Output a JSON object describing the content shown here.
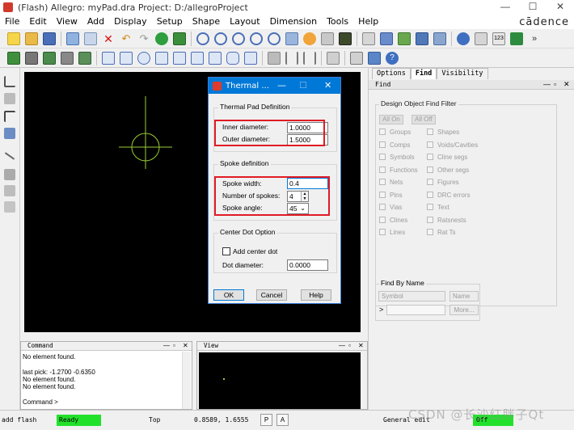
{
  "window": {
    "title": "(Flash) Allegro: myPad.dra  Project: D:/allegroProject",
    "minimize": "—",
    "maximize": "☐",
    "close": "✕"
  },
  "menu": [
    "File",
    "Edit",
    "View",
    "Add",
    "Display",
    "Setup",
    "Shape",
    "Layout",
    "Dimension",
    "Tools",
    "Help"
  ],
  "brand": "cādence",
  "toolbar_overflow": "»",
  "dialog": {
    "title": "Thermal ...",
    "thermal_pad": {
      "label": "Thermal Pad Definition",
      "inner_label": "Inner diameter:",
      "inner_value": "1.0000",
      "outer_label": "Outer diameter:",
      "outer_value": "1.5000"
    },
    "spoke": {
      "label": "Spoke definition",
      "width_label": "Spoke width:",
      "width_value": "0.4",
      "number_label": "Number of spokes:",
      "number_value": "4",
      "angle_label": "Spoke angle:",
      "angle_value": "45"
    },
    "center_dot": {
      "label": "Center Dot Option",
      "add_label": "Add center dot",
      "add_checked": false,
      "diameter_label": "Dot diameter:",
      "diameter_value": "0.0000"
    },
    "buttons": {
      "ok": "OK",
      "cancel": "Cancel",
      "help": "Help"
    }
  },
  "right_panel": {
    "tabs": [
      "Options",
      "Find",
      "Visibility"
    ],
    "active_tab": "Find",
    "header": "Find",
    "filter_title": "Design Object Find Filter",
    "all_on": "All On",
    "all_off": "All Off",
    "left_items": [
      "Groups",
      "Comps",
      "Symbols",
      "Functions",
      "Nets",
      "Pins",
      "Vias",
      "Clines",
      "Lines"
    ],
    "right_items": [
      "Shapes",
      "Voids/Cavities",
      "Cline segs",
      "Other segs",
      "Figures",
      "DRC errors",
      "Text",
      "Ratsnests",
      "Rat Ts"
    ],
    "find_by_name": {
      "title": "Find By Name",
      "type": "Symbol",
      "mode": "Name",
      "prompt": ">",
      "more": "More..."
    }
  },
  "command_window": {
    "label": "Command",
    "lines": [
      "No element found.",
      "",
      "last pick:  -1.2700 -0.6350",
      "No element found.",
      "No element found."
    ],
    "prompt": "Command >"
  },
  "view_window": {
    "label": "View"
  },
  "status": {
    "command": "add flash",
    "state": "Ready",
    "layer": "Top",
    "coords": "0.8589, 1.6555",
    "p_btn": "P",
    "a_btn": "A",
    "mode": "General edit",
    "off": "Off"
  },
  "watermark": "CSDN @长沙红胖子Qt",
  "colors": {
    "dialog_title": "#0078d7",
    "highlight_box": "#e01b24",
    "ready_status": "#22e12b",
    "canvas": "#000000",
    "pad_outline": "#9acd32"
  }
}
